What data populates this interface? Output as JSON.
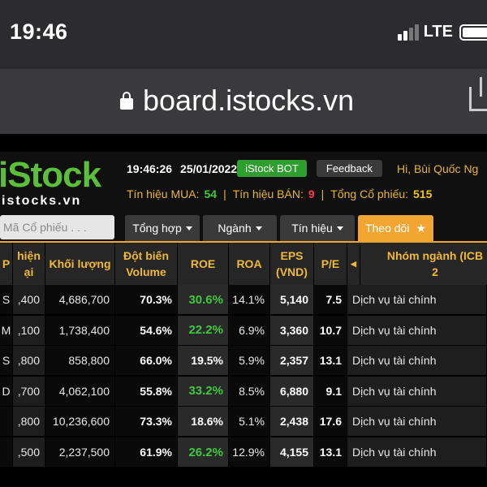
{
  "status_bar": {
    "time": "19:46",
    "network": "LTE"
  },
  "browser": {
    "url": "board.istocks.vn",
    "icons": [
      "lock-icon",
      "share-icon"
    ]
  },
  "app": {
    "logo": {
      "big": "iStock",
      "small": "istocks.vn",
      "color": "#5cbf3c"
    },
    "clock": "19:46:26",
    "date": "25/01/2022",
    "bot_button": "iStock BOT",
    "feedback_button": "Feedback",
    "greeting": "Hi, Bùi Quốc Ng",
    "signals": {
      "buy_label": "Tín hiệu MUA:",
      "buy_value": "54",
      "sell_label": "Tín hiệu BÁN:",
      "sell_value": "9",
      "total_label": "Tổng Cổ phiếu:",
      "total_value": "515"
    },
    "search_placeholder": "Mã Cổ phiếu . . .",
    "tabs": [
      {
        "label": "Tổng hợp"
      },
      {
        "label": "Ngành"
      },
      {
        "label": "Tín hiệu"
      },
      {
        "label": "Theo dõi",
        "active": true
      }
    ]
  },
  "table": {
    "headers": {
      "col0": "P",
      "col1_line1": "hiện",
      "col1_line2": "ại",
      "volume": "Khối lượng",
      "spike_line1": "Đột biến",
      "spike_line2": "Volume",
      "roe": "ROE",
      "roa": "ROA",
      "eps_line1": "EPS",
      "eps_line2": "(VND)",
      "pe": "P/E",
      "industry": "Nhóm ngành (ICB 2"
    },
    "rows": [
      {
        "c0": "S",
        "c1": ",400",
        "volume": "4,686,700",
        "spike": "70.3%",
        "roe": "30.6%",
        "roe_green": true,
        "roa": "14.1%",
        "eps": "5,140",
        "pe": "7.5",
        "industry": "Dịch vụ tài chính"
      },
      {
        "c0": "M",
        "c1": ",100",
        "volume": "1,738,400",
        "spike": "54.6%",
        "roe": "22.2%",
        "roe_green": true,
        "roa": "6.9%",
        "eps": "3,360",
        "pe": "10.7",
        "industry": "Dịch vụ tài chính"
      },
      {
        "c0": "S",
        "c1": ",800",
        "volume": "858,800",
        "spike": "66.0%",
        "roe": "19.5%",
        "roe_green": false,
        "roa": "5.9%",
        "eps": "2,357",
        "pe": "13.1",
        "industry": "Dịch vụ tài chính"
      },
      {
        "c0": "D",
        "c1": ",700",
        "volume": "4,062,100",
        "spike": "55.8%",
        "roe": "33.2%",
        "roe_green": true,
        "roa": "8.5%",
        "eps": "6,880",
        "pe": "9.1",
        "industry": "Dịch vụ tài chính"
      },
      {
        "c0": "",
        "c1": ",800",
        "volume": "10,236,600",
        "spike": "73.3%",
        "roe": "18.6%",
        "roe_green": false,
        "roa": "5.1%",
        "eps": "2,438",
        "pe": "17.6",
        "industry": "Dịch vụ tài chính"
      },
      {
        "c0": "",
        "c1": ",500",
        "volume": "2,237,500",
        "spike": "61.9%",
        "roe": "26.2%",
        "roe_green": true,
        "roa": "12.9%",
        "eps": "4,155",
        "pe": "13.1",
        "industry": "Dịch vụ tài chính"
      }
    ]
  },
  "colors": {
    "accent": "#f2a531",
    "header_text": "#f0b93a",
    "positive": "#3ec93e",
    "negative": "#ff3b3b"
  }
}
